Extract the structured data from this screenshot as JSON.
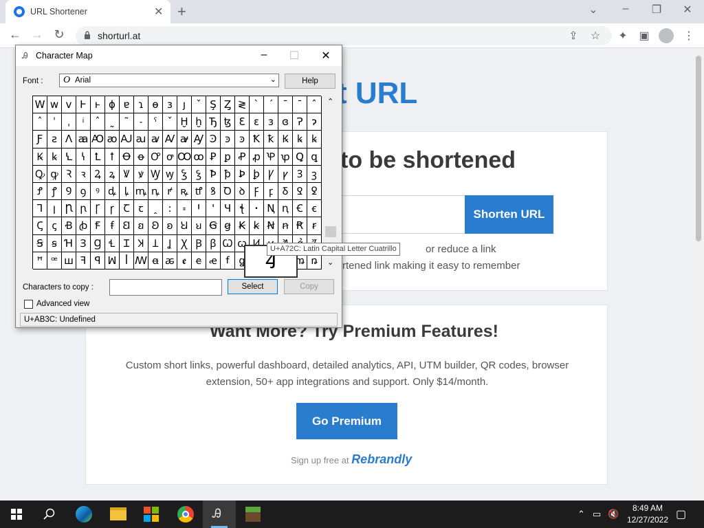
{
  "browser": {
    "tab_title": "URL Shortener",
    "url": "shorturl.at"
  },
  "page": {
    "logo_text": "t URL",
    "card1_heading": "to be shortened",
    "shorten_button": "Shorten URL",
    "help_line1": "or reduce a link",
    "help_line2": "rtened link making it easy to remember",
    "premium_title": "Want More? Try Premium Features!",
    "premium_desc": "Custom short links, powerful dashboard, detailed analytics, API, UTM builder, QR codes, browser extension, 50+ app integrations and support. Only $14/month.",
    "premium_button": "Go Premium",
    "signup_prefix": "Sign up free at",
    "signup_brand": "Rebrandly"
  },
  "charmap": {
    "title": "Character Map",
    "font_label": "Font :",
    "font_value": "Arial",
    "help_button": "Help",
    "chars_to_copy_label": "Characters to copy :",
    "chars_to_copy_value": "",
    "select_button": "Select",
    "copy_button": "Copy",
    "advanced_view_label": "Advanced view",
    "status": "U+AB3C: Undefined",
    "tooltip": "U+A72C: Latin Capital Letter Cuatrillo",
    "enlarged_char": "Ꜭ",
    "grid": [
      [
        "W",
        "w",
        "v",
        "Ͱ",
        "ͱ",
        "ɸ",
        "ɐ",
        "ɿ",
        "ɵ",
        "ɜ",
        "ȷ",
        "ˇ",
        "Ş",
        "Ȥ",
        "≷",
        "ˋ",
        "ˊ",
        "ˉ",
        "ˉ",
        "ˆ"
      ],
      [
        "ˆ",
        "ˈ",
        "ˌ",
        "ͥ",
        "ˆ",
        "˷",
        "˜",
        "˗",
        "ˁ",
        "ˇ",
        "Ḫ",
        "ḫ",
        "Ђ",
        "ꜩ",
        "Ɛ",
        "ɛ",
        "ɜ",
        "ɞ",
        "Ɂ",
        "ɂ"
      ],
      [
        "Ƒ",
        "ƨ",
        "Ʌ",
        "ꜳ",
        "Ꜵ",
        "ꜵ",
        "Ꜷ",
        "ꜷ",
        "ꜹ",
        "Ꜹ",
        "ꜻ",
        "Ꜽ",
        "Ꜿ",
        "ꜿ",
        "ꜿ",
        "Ꝁ",
        "ꝁ",
        "Ꝃ",
        "ꝃ",
        "ꝃ"
      ],
      [
        "Ꝃ",
        "ꝃ",
        "Ꝇ",
        "ꝇ",
        "Ꝉ",
        "ꝉ",
        "Ꝋ",
        "ꝋ",
        "Ꝍ",
        "ꝍ",
        "Ꝏ",
        "ꝏ",
        "Ꝑ",
        "ꝑ",
        "Ꝓ",
        "ꝓ",
        "Ꝕ",
        "ꝕ",
        "Ꝗ",
        "ꝗ"
      ],
      [
        "Ꝙ",
        "ꝙ",
        "Ꝛ",
        "ꝛ",
        "Ꝝ",
        "ꝝ",
        "Ꝟ",
        "ꝟ",
        "Ꝡ",
        "ꝡ",
        "Ꝣ",
        "ꝣ",
        "Ꝥ",
        "ꝥ",
        "Ꝧ",
        "ꝧ",
        "Ꝩ",
        "ꝩ",
        "Ꝫ",
        "ꝫ"
      ],
      [
        "Ꝭ",
        "ꝭ",
        "Ꝯ",
        "ꝯ",
        "ꝰ",
        "ꝱ",
        "ꝲ",
        "ꝳ",
        "ꝴ",
        "ꝵ",
        "ꝶ",
        "ꝷ",
        "ꝸ",
        "Ꝺ",
        "ꝺ",
        "Ꝼ",
        "ꝼ",
        "Ᵹ",
        "Ꝿ",
        "ꝿ"
      ],
      [
        "Ꞁ",
        "ꞁ",
        "Ꞃ",
        "ꞃ",
        "Ꞅ",
        "ꞅ",
        "Ꞇ",
        "ꞇ",
        "ꞈ",
        "꞉",
        "꞊",
        "Ꞌ",
        "ꞌ",
        "Ɥ",
        "ꞎ",
        "ꞏ",
        "Ꞑ",
        "ꞑ",
        "Ꞓ",
        "ꞓ"
      ],
      [
        "Ꞔ",
        "ꞔ",
        "Ꞗ",
        "ꞗ",
        "Ꞙ",
        "ꞙ",
        "Ꞛ",
        "ꞛ",
        "Ꞝ",
        "ꞝ",
        "Ꞟ",
        "ꞟ",
        "Ꞡ",
        "ꞡ",
        "Ꞣ",
        "ꞣ",
        "Ꞥ",
        "ꞥ",
        "Ꞧ",
        "ꞧ"
      ],
      [
        "Ꞩ",
        "ꞩ",
        "Ɦ",
        "Ɜ",
        "Ɡ",
        "Ɬ",
        "Ɪ",
        "Ʞ",
        "Ʇ",
        "Ʝ",
        "Ꭓ",
        "Ꞵ",
        "ꞵ",
        "Ꞷ",
        "ꞷ",
        "Ꞹ",
        "ꞹ",
        "Ꞻ",
        "ꞻ",
        "Ꞽ"
      ],
      [
        "ꟸ",
        "ꟹ",
        "ꟺ",
        "ꟻ",
        "ꟼ",
        "ꟽ",
        "ꟾ",
        "ꟿ",
        "ꬰ",
        "ꬱ",
        "ꬲ",
        "ꬳ",
        "ꬴ",
        "ꬵ",
        "ꬶ",
        "ꬷ",
        "ꬸ",
        "ꬹ",
        "ꬺ",
        "ꬻ"
      ]
    ]
  },
  "taskbar": {
    "time": "8:49 AM",
    "date": "12/27/2022"
  }
}
